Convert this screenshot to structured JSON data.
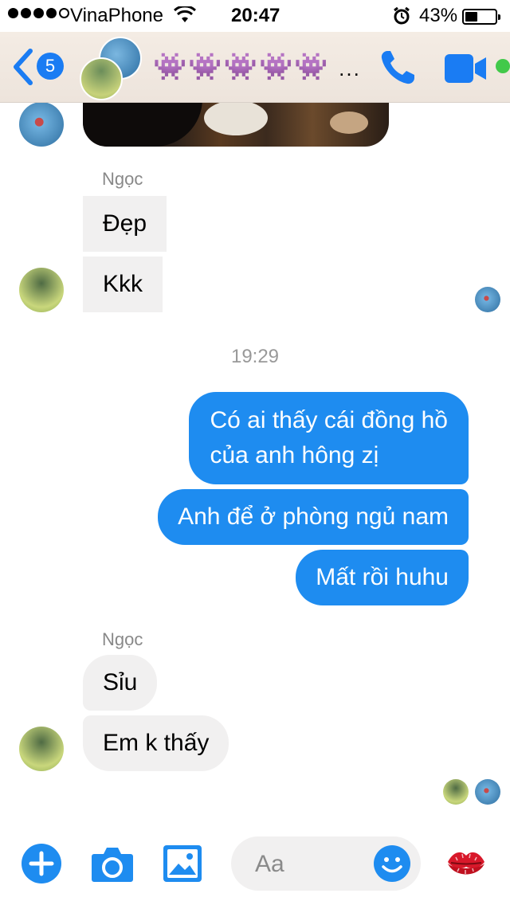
{
  "status_bar": {
    "carrier": "VinaPhone",
    "time": "20:47",
    "battery_percent": "43%",
    "battery_level": 0.43,
    "signal_bars": 4,
    "signal_max": 5
  },
  "header": {
    "back_badge_count": "5",
    "title": "👾👾👾👾👾",
    "title_ellipsis": "..."
  },
  "messages": {
    "sender_top": "Ngọc",
    "msg_dep": "Đẹp",
    "msg_kkk": "Kkk",
    "timestamp": "19:29",
    "out_1": "Có ai thấy cái đồng hồ\ncủa anh hông zị",
    "out_2": "Anh để ở phòng ngủ nam",
    "out_3": "Mất rồi huhu",
    "sender_bottom": "Ngọc",
    "msg_siu": "Sỉu",
    "msg_emk": "Em k thấy"
  },
  "composer": {
    "placeholder": "Aa"
  },
  "colors": {
    "accent": "#1e8cf0",
    "incoming_bubble": "#f1f0f0",
    "online": "#42c94a",
    "kiss_red": "#d8182a"
  },
  "icons": [
    "back-chevron-icon",
    "phone-icon",
    "video-camera-icon",
    "plus-icon",
    "camera-icon",
    "image-icon",
    "emoji-icon",
    "kiss-lips-icon",
    "wifi-icon",
    "alarm-icon"
  ]
}
